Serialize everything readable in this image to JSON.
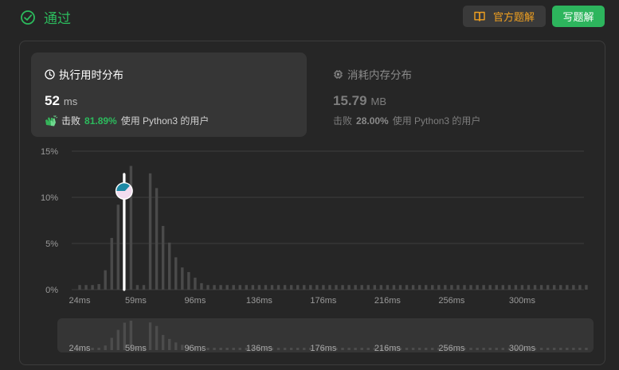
{
  "header": {
    "status": "通过",
    "official_solution_label": "官方题解",
    "write_solution_label": "写题解"
  },
  "runtime": {
    "title": "执行用时分布",
    "value": "52",
    "unit": "ms",
    "beats_label": "击败",
    "beats_pct": "81.89%",
    "beats_suffix": "使用 Python3 的用户"
  },
  "memory": {
    "title": "消耗内存分布",
    "value": "15.79",
    "unit": "MB",
    "beats_label": "击败",
    "beats_pct": "28.00%",
    "beats_suffix": "使用 Python3 的用户"
  },
  "colors": {
    "accent_green": "#2cbb5d",
    "solution_orange": "#f0a020",
    "bar": "#4a4a4a",
    "marker": "#ffffff"
  },
  "icons": {
    "status": "check-circle-icon",
    "solution": "book-icon",
    "runtime": "clock-icon",
    "memory": "chip-icon",
    "beats": "clapping-hands-icon",
    "marker": "avatar-icon"
  },
  "chart_data": {
    "type": "bar",
    "ylabel": "",
    "xlabel": "",
    "ylim": [
      0,
      15
    ],
    "yticks": [
      "0%",
      "5%",
      "10%",
      "15%"
    ],
    "xticks": [
      "24ms",
      "59ms",
      "96ms",
      "136ms",
      "176ms",
      "216ms",
      "256ms",
      "300ms"
    ],
    "x_start_ms": 24,
    "x_step_ms": 4,
    "values": [
      0.5,
      0.5,
      0.5,
      0.6,
      2.1,
      5.6,
      9.2,
      12.5,
      13.4,
      0.5,
      0.5,
      12.6,
      11.0,
      6.9,
      5.1,
      3.5,
      2.4,
      1.9,
      1.3,
      0.7,
      0.5,
      0.5,
      0.5,
      0.5,
      0.5,
      0.5,
      0.5,
      0.5,
      0.5,
      0.5,
      0.5,
      0.5,
      0.5,
      0.5,
      0.5,
      0.5,
      0.5,
      0.5,
      0.5,
      0.5,
      0.5,
      0.5,
      0.5,
      0.5,
      0.5,
      0.5,
      0.5,
      0.5,
      0.5,
      0.5,
      0.5,
      0.5,
      0.5,
      0.5,
      0.5,
      0.5,
      0.5,
      0.5,
      0.5,
      0.5,
      0.5,
      0.5,
      0.5,
      0.5,
      0.5,
      0.5,
      0.5,
      0.5,
      0.5,
      0.5,
      0.5,
      0.5,
      0.5,
      0.5,
      0.5,
      0.5,
      0.5,
      0.5,
      0.5,
      0.5
    ],
    "selected_ms": 52,
    "grid": true,
    "legend": "none"
  }
}
